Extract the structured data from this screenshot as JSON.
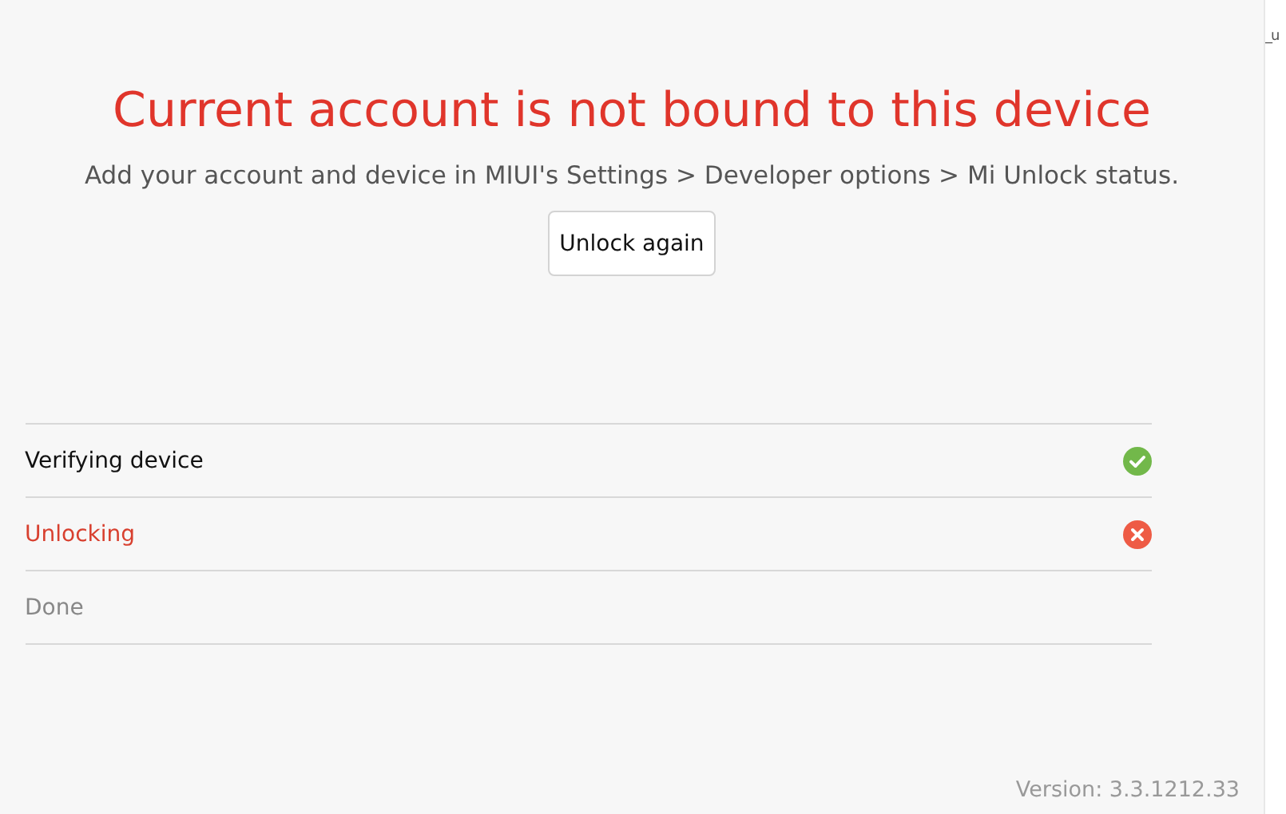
{
  "title": "Current account is not bound to this device",
  "message": "Add your account and device in MIUI's Settings > Developer options > Mi Unlock status.",
  "button": "Unlock again",
  "steps": [
    {
      "label": "Verifying device",
      "kind": "success"
    },
    {
      "label": "Unlocking",
      "kind": "error"
    },
    {
      "label": "Done",
      "kind": "pending"
    }
  ],
  "version": "Version: 3.3.1212.33",
  "side_window_text": "_u"
}
